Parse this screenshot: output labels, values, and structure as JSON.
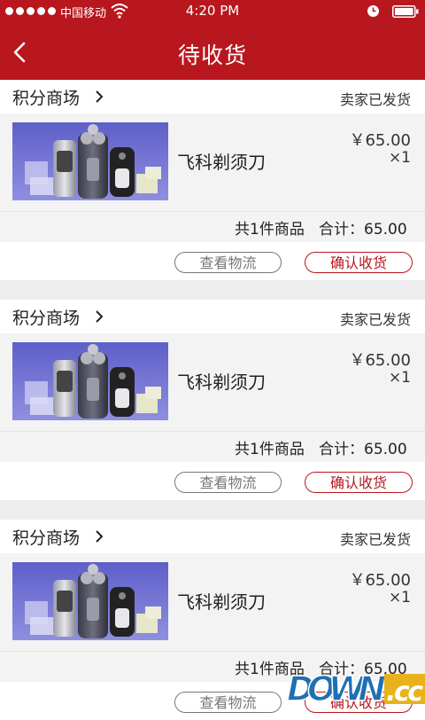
{
  "status_bar": {
    "carrier": "中国移动",
    "time": "4:20 PM"
  },
  "nav": {
    "title": "待收货"
  },
  "orders": [
    {
      "store": "积分商场",
      "status": "卖家已发货",
      "product": "飞科剃须刀",
      "price": "￥65.00",
      "qty": "×1",
      "count_text": "共1件商品",
      "total_text": "合计：65.00",
      "logistics_label": "查看物流",
      "confirm_label": "确认收货"
    },
    {
      "store": "积分商场",
      "status": "卖家已发货",
      "product": "飞科剃须刀",
      "price": "￥65.00",
      "qty": "×1",
      "count_text": "共1件商品",
      "total_text": "合计：65.00",
      "logistics_label": "查看物流",
      "confirm_label": "确认收货"
    },
    {
      "store": "积分商场",
      "status": "卖家已发货",
      "product": "飞科剃须刀",
      "price": "￥65.00",
      "qty": "×1",
      "count_text": "共1件商品",
      "total_text": "合计：65.00",
      "logistics_label": "查看物流",
      "confirm_label": "确认收货"
    }
  ],
  "watermark": {
    "text": "DOWN.CC"
  },
  "colors": {
    "brand_red": "#b8171e",
    "background": "#eeeeee",
    "item_row_bg": "#f3f3f3"
  },
  "icons": [
    "back-arrow-icon",
    "chevron-right-icon",
    "wifi-icon",
    "alarm-icon",
    "battery-icon",
    "signal-dots-icon"
  ]
}
